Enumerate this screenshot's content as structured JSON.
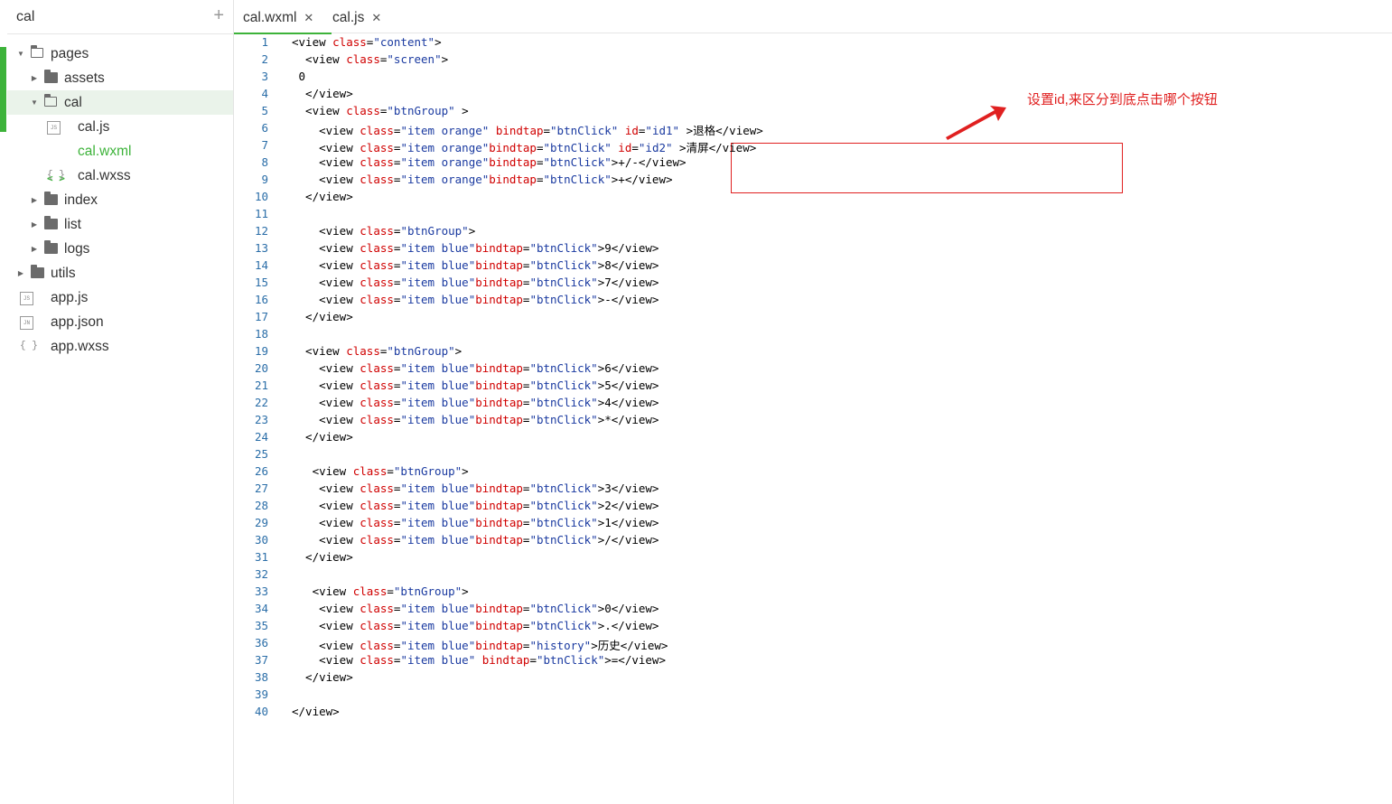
{
  "sidebar": {
    "title": "cal",
    "add_label": "+",
    "tree": [
      {
        "label": "pages",
        "type": "folder",
        "open": true,
        "depth": 0
      },
      {
        "label": "assets",
        "type": "folder",
        "open": false,
        "depth": 1
      },
      {
        "label": "cal",
        "type": "folder",
        "open": true,
        "depth": 1,
        "selected": true
      },
      {
        "label": "cal.js",
        "type": "js",
        "depth": 2
      },
      {
        "label": "cal.wxml",
        "type": "wxml",
        "depth": 2,
        "active": true
      },
      {
        "label": "cal.wxss",
        "type": "wxss",
        "depth": 2
      },
      {
        "label": "index",
        "type": "folder",
        "open": false,
        "depth": 1
      },
      {
        "label": "list",
        "type": "folder",
        "open": false,
        "depth": 1
      },
      {
        "label": "logs",
        "type": "folder",
        "open": false,
        "depth": 1
      },
      {
        "label": "utils",
        "type": "folder",
        "open": false,
        "depth": 0
      },
      {
        "label": "app.js",
        "type": "js",
        "depth": 0
      },
      {
        "label": "app.json",
        "type": "json",
        "depth": 0
      },
      {
        "label": "app.wxss",
        "type": "wxss",
        "depth": 0
      }
    ]
  },
  "tabs": [
    {
      "label": "cal.wxml",
      "close": "✕",
      "active": true
    },
    {
      "label": "cal.js",
      "close": "✕",
      "active": false
    }
  ],
  "editor": {
    "lines": [
      [
        {
          "t": "<view ",
          "c": "t"
        },
        {
          "t": "class",
          "c": "a"
        },
        {
          "t": "=",
          "c": "t"
        },
        {
          "t": "\"content\"",
          "c": "s"
        },
        {
          "t": ">",
          "c": "t"
        }
      ],
      [
        {
          "t": "  <view ",
          "c": "t"
        },
        {
          "t": "class",
          "c": "a"
        },
        {
          "t": "=",
          "c": "t"
        },
        {
          "t": "\"screen\"",
          "c": "s"
        },
        {
          "t": ">",
          "c": "t"
        }
      ],
      [
        {
          "t": " 0",
          "c": "t"
        }
      ],
      [
        {
          "t": "  </view>",
          "c": "t"
        }
      ],
      [
        {
          "t": "  <view ",
          "c": "t"
        },
        {
          "t": "class",
          "c": "a"
        },
        {
          "t": "=",
          "c": "t"
        },
        {
          "t": "\"btnGroup\"",
          "c": "s"
        },
        {
          "t": " >",
          "c": "t"
        }
      ],
      [
        {
          "t": "    <view ",
          "c": "t"
        },
        {
          "t": "class",
          "c": "a"
        },
        {
          "t": "=",
          "c": "t"
        },
        {
          "t": "\"item orange\"",
          "c": "s"
        },
        {
          "t": " ",
          "c": "t"
        },
        {
          "t": "bindtap",
          "c": "a"
        },
        {
          "t": "=",
          "c": "t"
        },
        {
          "t": "\"btnClick\"",
          "c": "s"
        },
        {
          "t": " ",
          "c": "t"
        },
        {
          "t": "id",
          "c": "a"
        },
        {
          "t": "=",
          "c": "t"
        },
        {
          "t": "\"id1\"",
          "c": "s"
        },
        {
          "t": " >退格</view>",
          "c": "t"
        }
      ],
      [
        {
          "t": "    <view ",
          "c": "t"
        },
        {
          "t": "class",
          "c": "a"
        },
        {
          "t": "=",
          "c": "t"
        },
        {
          "t": "\"item orange\"",
          "c": "s"
        },
        {
          "t": "bindtap",
          "c": "a"
        },
        {
          "t": "=",
          "c": "t"
        },
        {
          "t": "\"btnClick\"",
          "c": "s"
        },
        {
          "t": " ",
          "c": "t"
        },
        {
          "t": "id",
          "c": "a"
        },
        {
          "t": "=",
          "c": "t"
        },
        {
          "t": "\"id2\"",
          "c": "s"
        },
        {
          "t": " >清屏</view>",
          "c": "t"
        }
      ],
      [
        {
          "t": "    <view ",
          "c": "t"
        },
        {
          "t": "class",
          "c": "a"
        },
        {
          "t": "=",
          "c": "t"
        },
        {
          "t": "\"item orange\"",
          "c": "s"
        },
        {
          "t": "bindtap",
          "c": "a"
        },
        {
          "t": "=",
          "c": "t"
        },
        {
          "t": "\"btnClick\"",
          "c": "s"
        },
        {
          "t": ">+/-</view>",
          "c": "t"
        }
      ],
      [
        {
          "t": "    <view ",
          "c": "t"
        },
        {
          "t": "class",
          "c": "a"
        },
        {
          "t": "=",
          "c": "t"
        },
        {
          "t": "\"item orange\"",
          "c": "s"
        },
        {
          "t": "bindtap",
          "c": "a"
        },
        {
          "t": "=",
          "c": "t"
        },
        {
          "t": "\"btnClick\"",
          "c": "s"
        },
        {
          "t": ">+</view>",
          "c": "t"
        }
      ],
      [
        {
          "t": "  </view>",
          "c": "t"
        }
      ],
      [],
      [
        {
          "t": "    <view ",
          "c": "t"
        },
        {
          "t": "class",
          "c": "a"
        },
        {
          "t": "=",
          "c": "t"
        },
        {
          "t": "\"btnGroup\"",
          "c": "s"
        },
        {
          "t": ">",
          "c": "t"
        }
      ],
      [
        {
          "t": "    <view ",
          "c": "t"
        },
        {
          "t": "class",
          "c": "a"
        },
        {
          "t": "=",
          "c": "t"
        },
        {
          "t": "\"item blue\"",
          "c": "s"
        },
        {
          "t": "bindtap",
          "c": "a"
        },
        {
          "t": "=",
          "c": "t"
        },
        {
          "t": "\"btnClick\"",
          "c": "s"
        },
        {
          "t": ">9</view>",
          "c": "t"
        }
      ],
      [
        {
          "t": "    <view ",
          "c": "t"
        },
        {
          "t": "class",
          "c": "a"
        },
        {
          "t": "=",
          "c": "t"
        },
        {
          "t": "\"item blue\"",
          "c": "s"
        },
        {
          "t": "bindtap",
          "c": "a"
        },
        {
          "t": "=",
          "c": "t"
        },
        {
          "t": "\"btnClick\"",
          "c": "s"
        },
        {
          "t": ">8</view>",
          "c": "t"
        }
      ],
      [
        {
          "t": "    <view ",
          "c": "t"
        },
        {
          "t": "class",
          "c": "a"
        },
        {
          "t": "=",
          "c": "t"
        },
        {
          "t": "\"item blue\"",
          "c": "s"
        },
        {
          "t": "bindtap",
          "c": "a"
        },
        {
          "t": "=",
          "c": "t"
        },
        {
          "t": "\"btnClick\"",
          "c": "s"
        },
        {
          "t": ">7</view>",
          "c": "t"
        }
      ],
      [
        {
          "t": "    <view ",
          "c": "t"
        },
        {
          "t": "class",
          "c": "a"
        },
        {
          "t": "=",
          "c": "t"
        },
        {
          "t": "\"item blue\"",
          "c": "s"
        },
        {
          "t": "bindtap",
          "c": "a"
        },
        {
          "t": "=",
          "c": "t"
        },
        {
          "t": "\"btnClick\"",
          "c": "s"
        },
        {
          "t": ">-</view>",
          "c": "t"
        }
      ],
      [
        {
          "t": "  </view>",
          "c": "t"
        }
      ],
      [],
      [
        {
          "t": "  <view ",
          "c": "t"
        },
        {
          "t": "class",
          "c": "a"
        },
        {
          "t": "=",
          "c": "t"
        },
        {
          "t": "\"btnGroup\"",
          "c": "s"
        },
        {
          "t": ">",
          "c": "t"
        }
      ],
      [
        {
          "t": "    <view ",
          "c": "t"
        },
        {
          "t": "class",
          "c": "a"
        },
        {
          "t": "=",
          "c": "t"
        },
        {
          "t": "\"item blue\"",
          "c": "s"
        },
        {
          "t": "bindtap",
          "c": "a"
        },
        {
          "t": "=",
          "c": "t"
        },
        {
          "t": "\"btnClick\"",
          "c": "s"
        },
        {
          "t": ">6</view>",
          "c": "t"
        }
      ],
      [
        {
          "t": "    <view ",
          "c": "t"
        },
        {
          "t": "class",
          "c": "a"
        },
        {
          "t": "=",
          "c": "t"
        },
        {
          "t": "\"item blue\"",
          "c": "s"
        },
        {
          "t": "bindtap",
          "c": "a"
        },
        {
          "t": "=",
          "c": "t"
        },
        {
          "t": "\"btnClick\"",
          "c": "s"
        },
        {
          "t": ">5</view>",
          "c": "t"
        }
      ],
      [
        {
          "t": "    <view ",
          "c": "t"
        },
        {
          "t": "class",
          "c": "a"
        },
        {
          "t": "=",
          "c": "t"
        },
        {
          "t": "\"item blue\"",
          "c": "s"
        },
        {
          "t": "bindtap",
          "c": "a"
        },
        {
          "t": "=",
          "c": "t"
        },
        {
          "t": "\"btnClick\"",
          "c": "s"
        },
        {
          "t": ">4</view>",
          "c": "t"
        }
      ],
      [
        {
          "t": "    <view ",
          "c": "t"
        },
        {
          "t": "class",
          "c": "a"
        },
        {
          "t": "=",
          "c": "t"
        },
        {
          "t": "\"item blue\"",
          "c": "s"
        },
        {
          "t": "bindtap",
          "c": "a"
        },
        {
          "t": "=",
          "c": "t"
        },
        {
          "t": "\"btnClick\"",
          "c": "s"
        },
        {
          "t": ">*</view>",
          "c": "t"
        }
      ],
      [
        {
          "t": "  </view>",
          "c": "t"
        }
      ],
      [],
      [
        {
          "t": "   <view ",
          "c": "t"
        },
        {
          "t": "class",
          "c": "a"
        },
        {
          "t": "=",
          "c": "t"
        },
        {
          "t": "\"btnGroup\"",
          "c": "s"
        },
        {
          "t": ">",
          "c": "t"
        }
      ],
      [
        {
          "t": "    <view ",
          "c": "t"
        },
        {
          "t": "class",
          "c": "a"
        },
        {
          "t": "=",
          "c": "t"
        },
        {
          "t": "\"item blue\"",
          "c": "s"
        },
        {
          "t": "bindtap",
          "c": "a"
        },
        {
          "t": "=",
          "c": "t"
        },
        {
          "t": "\"btnClick\"",
          "c": "s"
        },
        {
          "t": ">3</view>",
          "c": "t"
        }
      ],
      [
        {
          "t": "    <view ",
          "c": "t"
        },
        {
          "t": "class",
          "c": "a"
        },
        {
          "t": "=",
          "c": "t"
        },
        {
          "t": "\"item blue\"",
          "c": "s"
        },
        {
          "t": "bindtap",
          "c": "a"
        },
        {
          "t": "=",
          "c": "t"
        },
        {
          "t": "\"btnClick\"",
          "c": "s"
        },
        {
          "t": ">2</view>",
          "c": "t"
        }
      ],
      [
        {
          "t": "    <view ",
          "c": "t"
        },
        {
          "t": "class",
          "c": "a"
        },
        {
          "t": "=",
          "c": "t"
        },
        {
          "t": "\"item blue\"",
          "c": "s"
        },
        {
          "t": "bindtap",
          "c": "a"
        },
        {
          "t": "=",
          "c": "t"
        },
        {
          "t": "\"btnClick\"",
          "c": "s"
        },
        {
          "t": ">1</view>",
          "c": "t"
        }
      ],
      [
        {
          "t": "    <view ",
          "c": "t"
        },
        {
          "t": "class",
          "c": "a"
        },
        {
          "t": "=",
          "c": "t"
        },
        {
          "t": "\"item blue\"",
          "c": "s"
        },
        {
          "t": "bindtap",
          "c": "a"
        },
        {
          "t": "=",
          "c": "t"
        },
        {
          "t": "\"btnClick\"",
          "c": "s"
        },
        {
          "t": ">/</view>",
          "c": "t"
        }
      ],
      [
        {
          "t": "  </view>",
          "c": "t"
        }
      ],
      [],
      [
        {
          "t": "   <view ",
          "c": "t"
        },
        {
          "t": "class",
          "c": "a"
        },
        {
          "t": "=",
          "c": "t"
        },
        {
          "t": "\"btnGroup\"",
          "c": "s"
        },
        {
          "t": ">",
          "c": "t"
        }
      ],
      [
        {
          "t": "    <view ",
          "c": "t"
        },
        {
          "t": "class",
          "c": "a"
        },
        {
          "t": "=",
          "c": "t"
        },
        {
          "t": "\"item blue\"",
          "c": "s"
        },
        {
          "t": "bindtap",
          "c": "a"
        },
        {
          "t": "=",
          "c": "t"
        },
        {
          "t": "\"btnClick\"",
          "c": "s"
        },
        {
          "t": ">0</view>",
          "c": "t"
        }
      ],
      [
        {
          "t": "    <view ",
          "c": "t"
        },
        {
          "t": "class",
          "c": "a"
        },
        {
          "t": "=",
          "c": "t"
        },
        {
          "t": "\"item blue\"",
          "c": "s"
        },
        {
          "t": "bindtap",
          "c": "a"
        },
        {
          "t": "=",
          "c": "t"
        },
        {
          "t": "\"btnClick\"",
          "c": "s"
        },
        {
          "t": ">.</view>",
          "c": "t"
        }
      ],
      [
        {
          "t": "    <view ",
          "c": "t"
        },
        {
          "t": "class",
          "c": "a"
        },
        {
          "t": "=",
          "c": "t"
        },
        {
          "t": "\"item blue\"",
          "c": "s"
        },
        {
          "t": "bindtap",
          "c": "a"
        },
        {
          "t": "=",
          "c": "t"
        },
        {
          "t": "\"history\"",
          "c": "s"
        },
        {
          "t": ">历史</view>",
          "c": "t"
        }
      ],
      [
        {
          "t": "    <view ",
          "c": "t"
        },
        {
          "t": "class",
          "c": "a"
        },
        {
          "t": "=",
          "c": "t"
        },
        {
          "t": "\"item blue\"",
          "c": "s"
        },
        {
          "t": " ",
          "c": "t"
        },
        {
          "t": "bindtap",
          "c": "a"
        },
        {
          "t": "=",
          "c": "t"
        },
        {
          "t": "\"btnClick\"",
          "c": "s"
        },
        {
          "t": ">=</view>",
          "c": "t"
        }
      ],
      [
        {
          "t": "  </view>",
          "c": "t"
        }
      ],
      [],
      [
        {
          "t": "</view>",
          "c": "t"
        }
      ]
    ]
  },
  "annotation": {
    "text": "设置id,来区分到底点击哪个按钮",
    "color": "#e02020"
  },
  "colors": {
    "accent": "#3db33a",
    "line_number": "#2b6ea8",
    "attr": "#d00000",
    "string": "#1a3aa0"
  }
}
